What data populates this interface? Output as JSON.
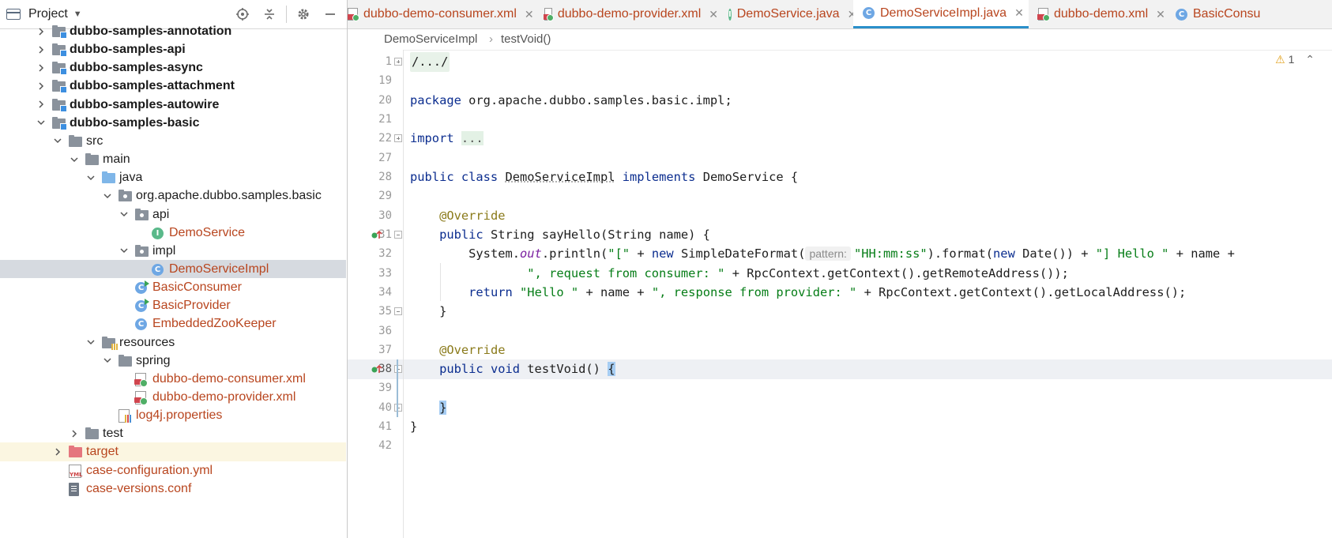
{
  "project_panel": {
    "title": "Project",
    "tree": [
      {
        "label": "dubbo-samples-annotation",
        "depth": 2,
        "expanded": false,
        "icon": "module-folder",
        "style": "bold"
      },
      {
        "label": "dubbo-samples-api",
        "depth": 2,
        "expanded": false,
        "icon": "module-folder",
        "style": "bold"
      },
      {
        "label": "dubbo-samples-async",
        "depth": 2,
        "expanded": false,
        "icon": "module-folder",
        "style": "bold"
      },
      {
        "label": "dubbo-samples-attachment",
        "depth": 2,
        "expanded": false,
        "icon": "module-folder",
        "style": "bold"
      },
      {
        "label": "dubbo-samples-autowire",
        "depth": 2,
        "expanded": false,
        "icon": "module-folder",
        "style": "bold"
      },
      {
        "label": "dubbo-samples-basic",
        "depth": 2,
        "expanded": true,
        "icon": "module-folder",
        "style": "bold"
      },
      {
        "label": "src",
        "depth": 3,
        "expanded": true,
        "icon": "folder"
      },
      {
        "label": "main",
        "depth": 4,
        "expanded": true,
        "icon": "folder"
      },
      {
        "label": "java",
        "depth": 5,
        "expanded": true,
        "icon": "source-folder"
      },
      {
        "label": "org.apache.dubbo.samples.basic",
        "depth": 6,
        "expanded": true,
        "icon": "package"
      },
      {
        "label": "api",
        "depth": 7,
        "expanded": true,
        "icon": "package"
      },
      {
        "label": "DemoService",
        "depth": 8,
        "icon": "interface",
        "style": "file"
      },
      {
        "label": "impl",
        "depth": 7,
        "expanded": true,
        "icon": "package"
      },
      {
        "label": "DemoServiceImpl",
        "depth": 8,
        "icon": "class",
        "style": "file",
        "selected": true
      },
      {
        "label": "BasicConsumer",
        "depth": 7,
        "icon": "class-runnable",
        "style": "file"
      },
      {
        "label": "BasicProvider",
        "depth": 7,
        "icon": "class-runnable",
        "style": "file"
      },
      {
        "label": "EmbeddedZooKeeper",
        "depth": 7,
        "icon": "class",
        "style": "file"
      },
      {
        "label": "resources",
        "depth": 5,
        "expanded": true,
        "icon": "resources-folder"
      },
      {
        "label": "spring",
        "depth": 6,
        "expanded": true,
        "icon": "folder"
      },
      {
        "label": "dubbo-demo-consumer.xml",
        "depth": 7,
        "icon": "xml",
        "style": "file"
      },
      {
        "label": "dubbo-demo-provider.xml",
        "depth": 7,
        "icon": "xml",
        "style": "file"
      },
      {
        "label": "log4j.properties",
        "depth": 6,
        "icon": "properties",
        "style": "file"
      },
      {
        "label": "test",
        "depth": 4,
        "expanded": false,
        "icon": "folder"
      },
      {
        "label": "target",
        "depth": 3,
        "expanded": false,
        "icon": "excluded-folder",
        "style": "file",
        "highlighted": true
      },
      {
        "label": "case-configuration.yml",
        "depth": 3,
        "icon": "yml",
        "style": "file"
      },
      {
        "label": "case-versions.conf",
        "depth": 3,
        "icon": "conf",
        "style": "file"
      }
    ]
  },
  "tabs": [
    {
      "label": "dubbo-demo-consumer.xml",
      "icon": "xml"
    },
    {
      "label": "dubbo-demo-provider.xml",
      "icon": "xml"
    },
    {
      "label": "DemoService.java",
      "icon": "interface"
    },
    {
      "label": "DemoServiceImpl.java",
      "icon": "class",
      "active": true
    },
    {
      "label": "dubbo-demo.xml",
      "icon": "xml"
    },
    {
      "label": "BasicConsu",
      "icon": "class-runnable"
    }
  ],
  "breadcrumb": [
    "DemoServiceImpl",
    "testVoid()"
  ],
  "editor": {
    "warning_count": "1",
    "param_hint": "pattern:",
    "lines": [
      {
        "num": "1"
      },
      {
        "num": "19"
      },
      {
        "num": "20"
      },
      {
        "num": "21"
      },
      {
        "num": "22"
      },
      {
        "num": "27"
      },
      {
        "num": "28"
      },
      {
        "num": "29"
      },
      {
        "num": "30"
      },
      {
        "num": "31"
      },
      {
        "num": "32"
      },
      {
        "num": "33"
      },
      {
        "num": "34"
      },
      {
        "num": "35"
      },
      {
        "num": "36"
      },
      {
        "num": "37"
      },
      {
        "num": "38"
      },
      {
        "num": "39"
      },
      {
        "num": "40"
      },
      {
        "num": "41"
      },
      {
        "num": "42"
      }
    ],
    "code": {
      "l1": "/.../",
      "l20_kw": "package",
      "l20_rest": " org.apache.dubbo.samples.basic.impl;",
      "l22_kw": "import",
      "l22_fold": "...",
      "l28_a": "public class",
      "l28_b": "DemoServiceImpl",
      "l28_c": "implements",
      "l28_d": " DemoService {",
      "l30": "@Override",
      "l31_kw": "public",
      "l31_rest": " String sayHello(String name) {",
      "l32_a": "System.",
      "l32_b": "out",
      "l32_c": ".println(",
      "l32_d": "\"[\"",
      "l32_e": " + ",
      "l32_f": "new",
      "l32_g": " SimpleDateFormat(",
      "l32_h": "\"HH:mm:ss\"",
      "l32_i": ").format(",
      "l32_j": "new",
      "l32_k": " Date()) + ",
      "l32_l": "\"] Hello \"",
      "l32_m": " + name +",
      "l33_a": "\", request from consumer: \"",
      "l33_b": " + RpcContext.getContext().getRemoteAddress());",
      "l34_kw": "return",
      "l34_a": "\"Hello \"",
      "l34_b": " + name + ",
      "l34_c": "\", response from provider: \"",
      "l34_d": " + RpcContext.getContext().getLocalAddress();",
      "l35": "}",
      "l37": "@Override",
      "l38_kw": "public void",
      "l38_rest": " testVoid() ",
      "l38_brace": "{",
      "l40_brace": "}",
      "l41": "}"
    }
  },
  "colors": {
    "keyword": "#0b2d8f",
    "string": "#067d17",
    "annotation": "#8a7a1a",
    "file_label": "#b8451e",
    "active_tab_underline": "#2a8fca"
  }
}
